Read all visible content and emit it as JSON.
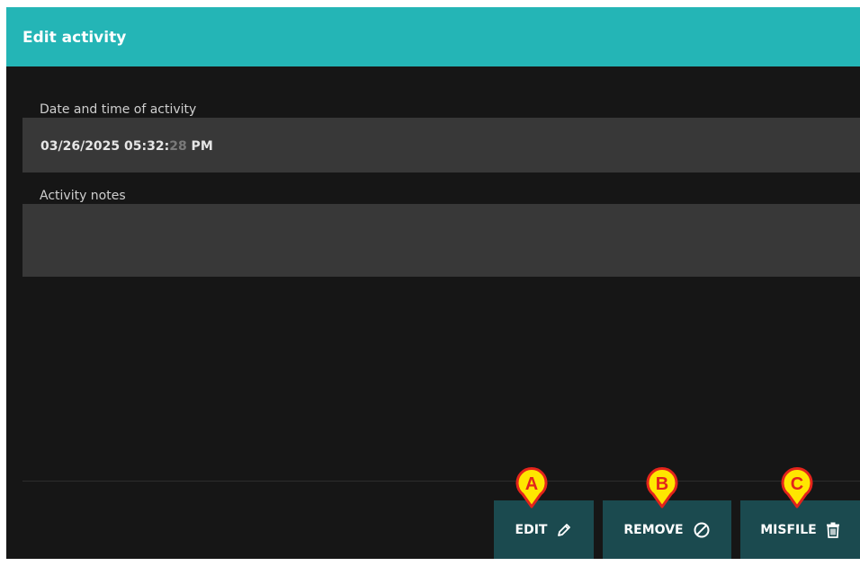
{
  "dialog": {
    "title": "Edit activity"
  },
  "fields": {
    "datetime_label": "Date and time of activity",
    "datetime_value": "03/26/2025 05:32:",
    "datetime_seconds": "28",
    "datetime_ampm": " PM",
    "notes_label": "Activity notes",
    "notes_value": ""
  },
  "buttons": {
    "edit": {
      "label": "EDIT",
      "icon": "pencil-icon",
      "marker": "A"
    },
    "remove": {
      "label": "REMOVE",
      "icon": "ban-icon",
      "marker": "B"
    },
    "misfile": {
      "label": "MISFILE",
      "icon": "trash-icon",
      "marker": "C"
    }
  },
  "colors": {
    "header": "#24b5b6",
    "background": "#161616",
    "field": "#383838",
    "button": "#1b4a4f",
    "marker_fill": "#ffe600",
    "marker_border": "#e3241b"
  }
}
